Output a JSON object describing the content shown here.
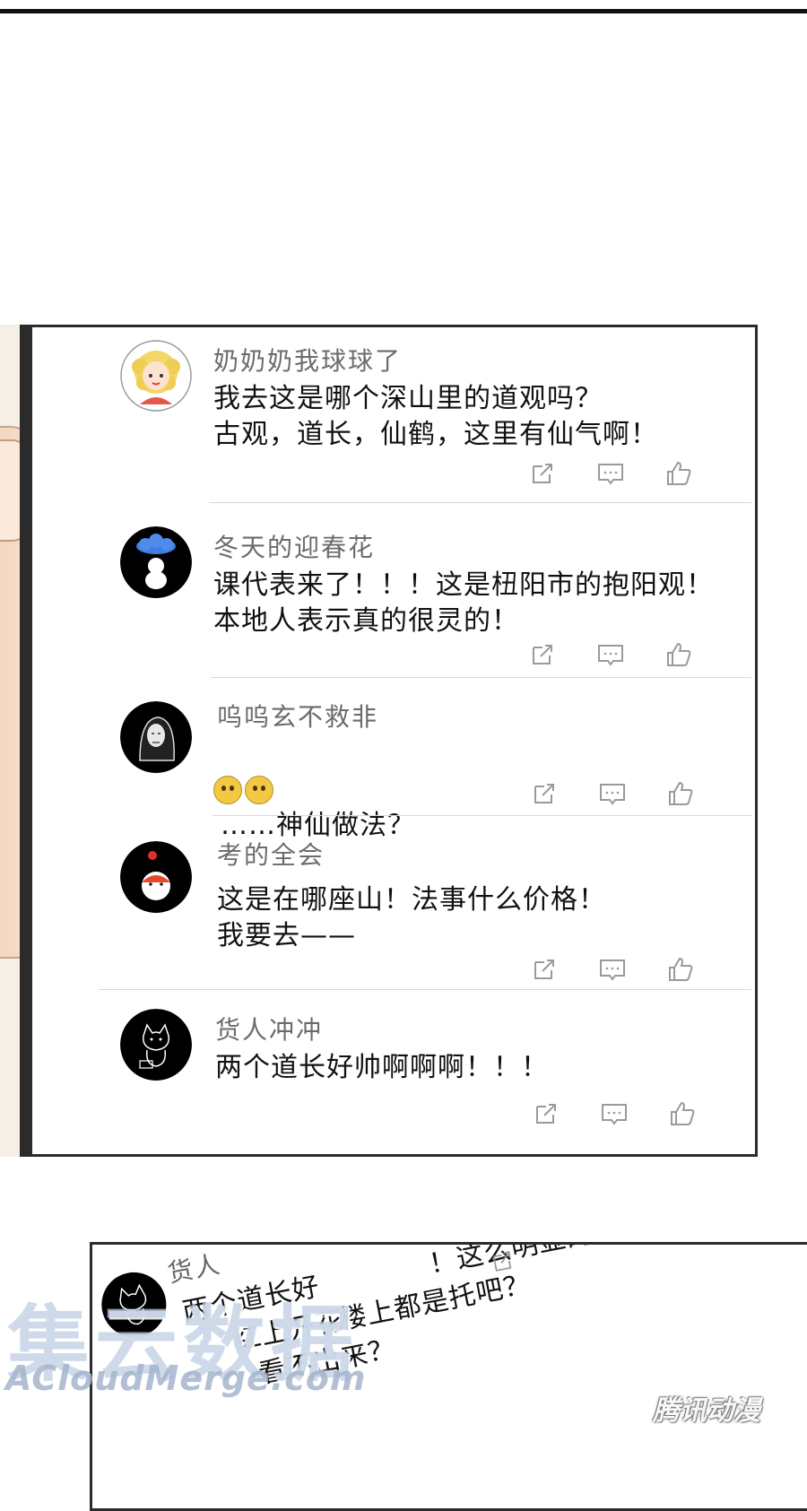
{
  "comments": [
    {
      "username": "奶奶奶我球球了",
      "text": "我去这是哪个深山里的道观吗？\n古观，道长，仙鹤，这里有仙气啊！",
      "avatar_icon": "curly-hair-girl-avatar"
    },
    {
      "username": "冬天的迎春花",
      "text": "课代表来了！！！这是杻阳市的抱阳观！\n本地人表示真的很灵的！",
      "avatar_icon": "cloud-ghost-avatar"
    },
    {
      "username": "呜呜玄不救非",
      "text": "……神仙做法？",
      "emoji": "🤔🤔",
      "avatar_icon": "hooded-figure-avatar"
    },
    {
      "username": "考的全会",
      "text": "这是在哪座山！法事什么价格！\n我要去——",
      "avatar_icon": "red-fox-avatar"
    },
    {
      "username": "货人冲冲",
      "text": "两个道长好帅啊啊啊！！！",
      "avatar_icon": "cat-sketch-avatar"
    }
  ],
  "action_icons": [
    "share-icon",
    "comment-icon",
    "like-icon"
  ],
  "partial_panel": {
    "username": "货人",
    "lines": [
      "两个道长好",
      "！这么明显的",
      "红上开花",
      "楼上都是托吧？",
      "看不出来？"
    ]
  },
  "watermark": {
    "big": "集云数据",
    "small": "ACloudMerge.com",
    "corner": "腾讯动漫"
  },
  "colors": {
    "frame": "#2b2b2b",
    "username": "#6b6b6b",
    "text": "#111111",
    "icon": "#9a9a9a"
  }
}
